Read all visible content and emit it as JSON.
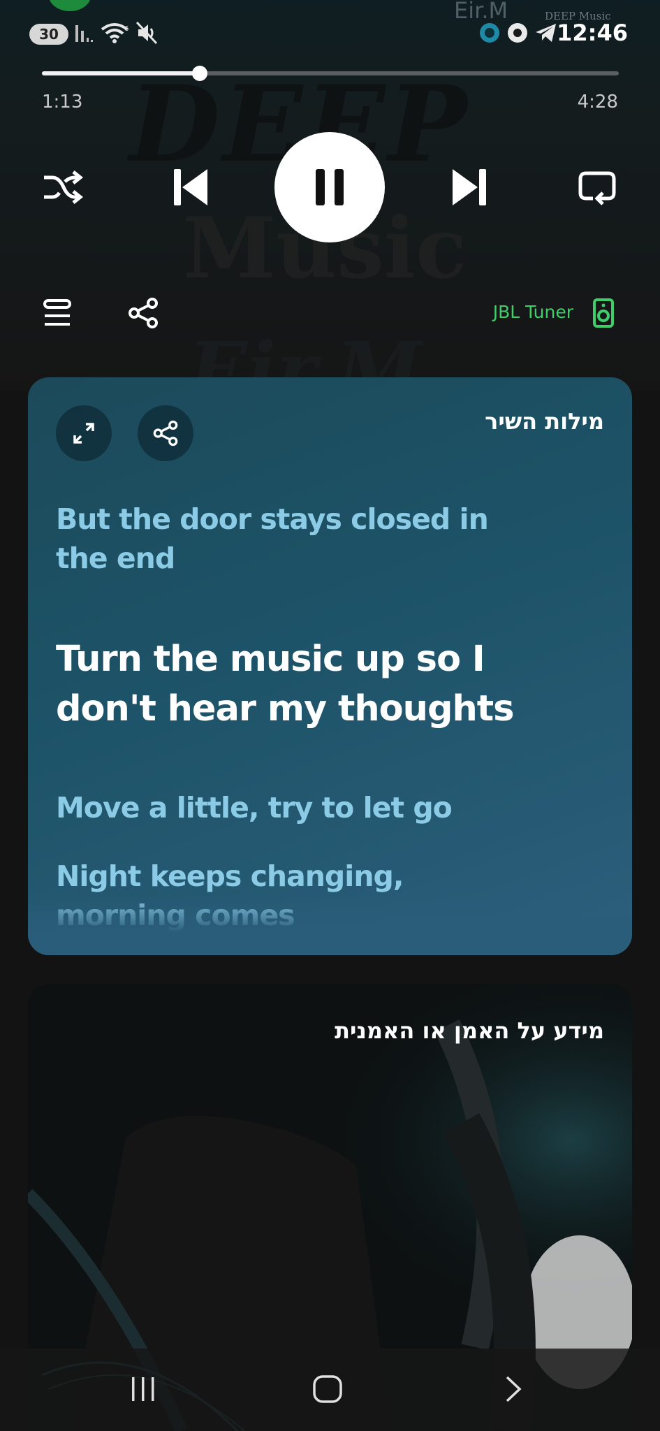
{
  "status_bar": {
    "badge": "30",
    "time": "12:46",
    "top_artist_fragment": "Eir.M",
    "top_art_fragment": "DEEP Music"
  },
  "background_art": {
    "line1": "DEEP",
    "line2": "Music",
    "line3": "Eir.M"
  },
  "player": {
    "elapsed": "1:13",
    "duration": "4:28",
    "progress_fraction": 0.274
  },
  "output": {
    "device_name": "JBL Tuner"
  },
  "lyrics": {
    "title": "מילות השיר",
    "lines": [
      {
        "text": "But the door stays closed in the end",
        "state": "past"
      },
      {
        "text": "Turn the music up so I don't hear my thoughts",
        "state": "current"
      },
      {
        "text": "Move a little, try to let go",
        "state": "upcoming"
      },
      {
        "text": "Night keeps changing, morning comes",
        "state": "upcoming"
      }
    ]
  },
  "artist_section": {
    "title": "מידע על האמן או האמנית"
  },
  "colors": {
    "accent_green": "#3fce6a",
    "lyrics_card": "#1d5368"
  },
  "icons": [
    "shuffle-icon",
    "previous-icon",
    "pause-icon",
    "next-icon",
    "repeat-icon",
    "queue-icon",
    "share-icon",
    "speaker-icon",
    "expand-icon",
    "menu-icon",
    "home-icon",
    "back-icon"
  ]
}
